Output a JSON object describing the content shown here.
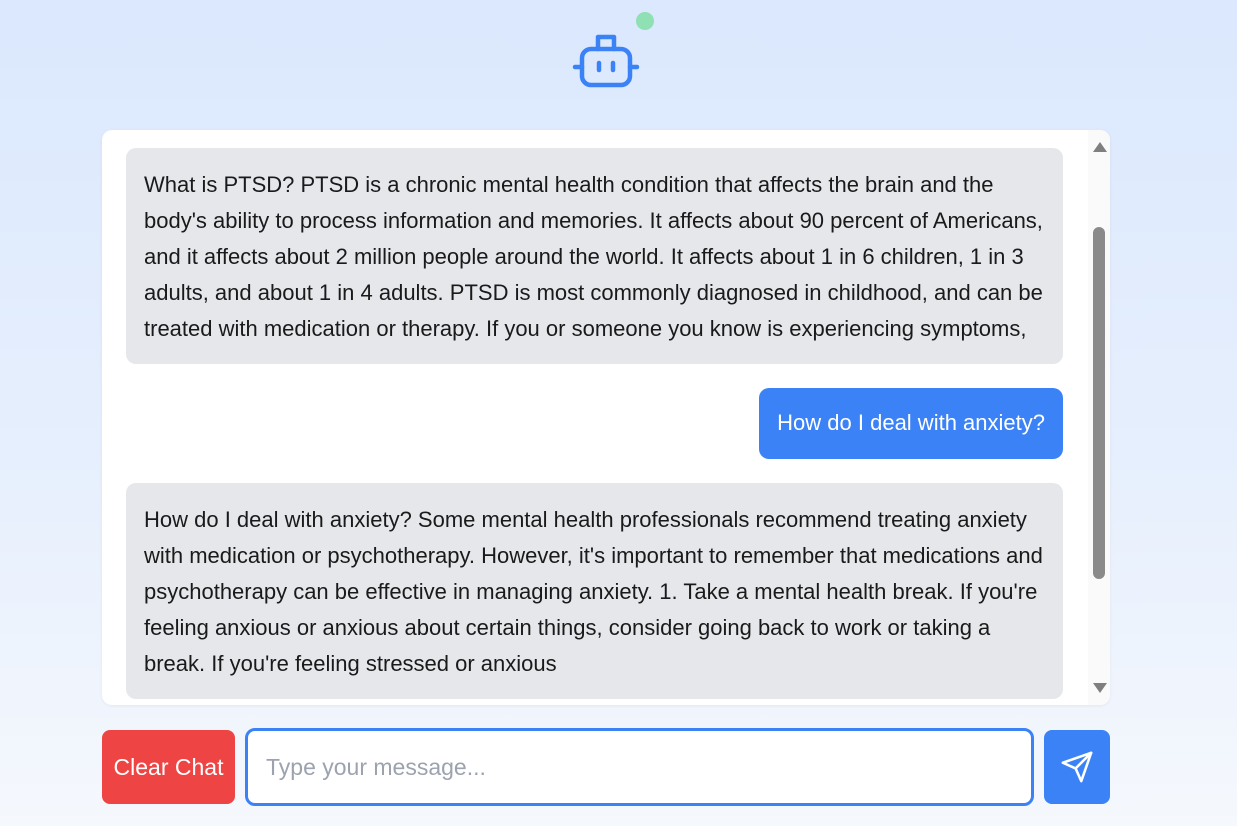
{
  "header": {
    "icon": "robot-icon",
    "status_icon": "online-status-dot",
    "status_color": "#8fe0b3"
  },
  "messages": [
    {
      "role": "bot",
      "text": "What is PTSD? PTSD is a chronic mental health condition that affects the brain and the body's ability to process information and memories. It affects about 90 percent of Americans, and it affects about 2 million people around the world. It affects about 1 in 6 children, 1 in 3 adults, and about 1 in 4 adults. PTSD is most commonly diagnosed in childhood, and can be treated with medication or therapy. If you or someone you know is experiencing symptoms,"
    },
    {
      "role": "user",
      "text": "How do I deal with anxiety?"
    },
    {
      "role": "bot",
      "text": "How do I deal with anxiety? Some mental health professionals recommend treating anxiety with medication or psychotherapy. However, it's important to remember that medications and psychotherapy can be effective in managing anxiety. 1. Take a mental health break. If you're feeling anxious or anxious about certain things, consider going back to work or taking a break. If you're feeling stressed or anxious"
    }
  ],
  "controls": {
    "clear_label": "Clear Chat",
    "input_placeholder": "Type your message...",
    "input_value": "",
    "send_icon": "send-icon"
  },
  "colors": {
    "accent": "#3b82f6",
    "danger": "#ef4444",
    "bot_bubble": "#e5e7eb",
    "user_bubble": "#3b82f6"
  }
}
